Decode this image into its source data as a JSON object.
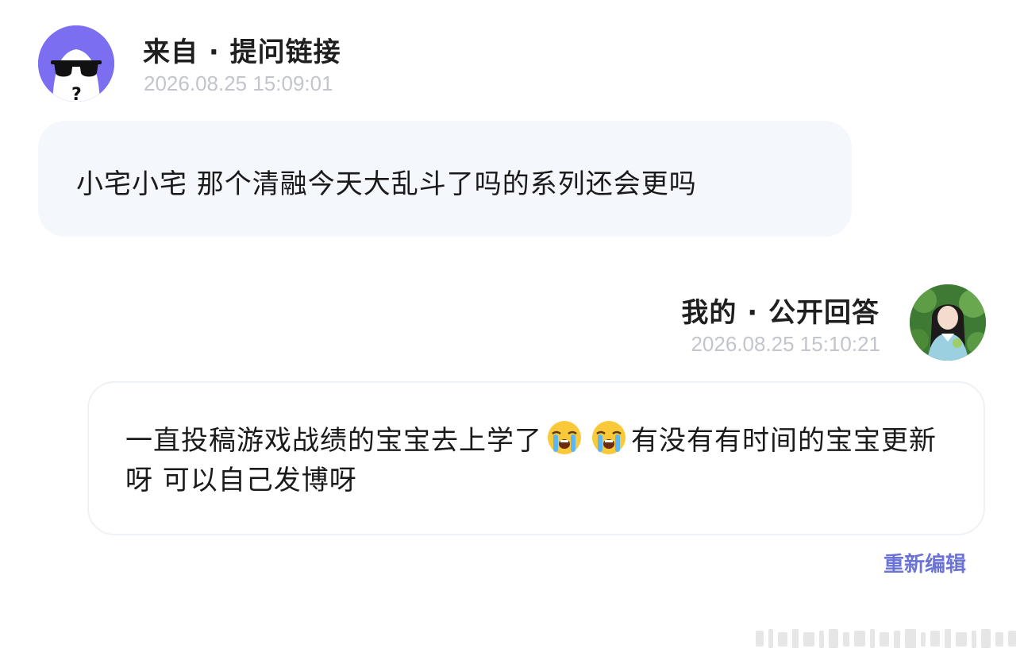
{
  "question": {
    "header": "来自 · 提问链接",
    "timestamp": "2026.08.25 15:09:01",
    "text": "小宅小宅 那个清融今天大乱斗了吗的系列还会更吗",
    "avatar_icon": "sunglasses-ghost-avatar",
    "avatar_color": "#7b6ef0"
  },
  "answer": {
    "header": "我的 · 公开回答",
    "timestamp": "2026.08.25 15:10:21",
    "text_part1": "一直投稿游戏战绩的宝宝去上学了",
    "emoji": "loudly-crying-face-icon",
    "text_part2": "有没有有时间的宝宝更新呀 可以自己发博呀",
    "avatar_icon": "user-photo-avatar"
  },
  "actions": {
    "edit_label": "重新编辑",
    "accent_color": "#6b74d6"
  }
}
